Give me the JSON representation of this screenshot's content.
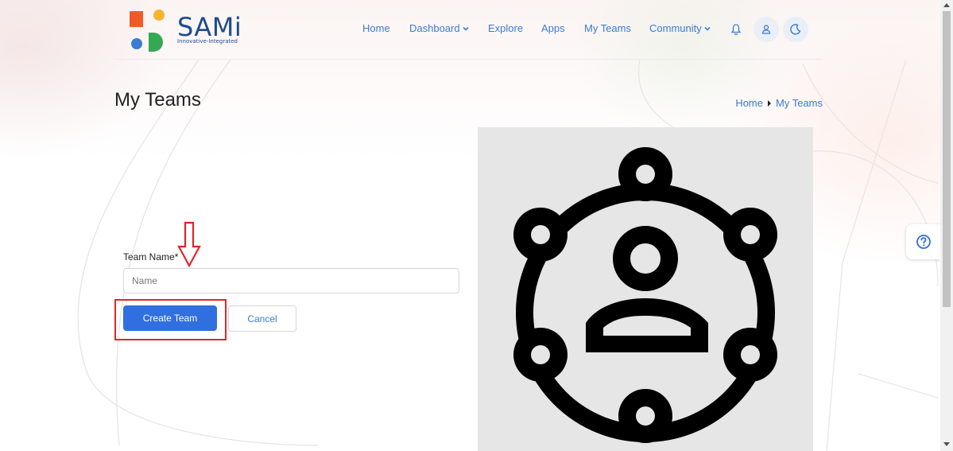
{
  "brand": {
    "name": "SAMi",
    "tagline": "Innovative-Integrated",
    "colors": {
      "orange": "#f05a28",
      "yellow": "#f7b42c",
      "blue": "#3a7bd5",
      "green": "#34a853",
      "navy": "#1d4b8f"
    }
  },
  "nav": {
    "items": [
      {
        "label": "Home",
        "has_dropdown": false
      },
      {
        "label": "Dashboard",
        "has_dropdown": true
      },
      {
        "label": "Explore",
        "has_dropdown": false
      },
      {
        "label": "Apps",
        "has_dropdown": false
      },
      {
        "label": "My Teams",
        "has_dropdown": false
      },
      {
        "label": "Community",
        "has_dropdown": true
      }
    ],
    "icons": [
      "bell-icon",
      "user-icon",
      "moon-icon"
    ]
  },
  "page": {
    "title": "My Teams",
    "breadcrumb": [
      "Home",
      "My Teams"
    ]
  },
  "form": {
    "team_name_label": "Team Name*",
    "team_name_placeholder": "Name",
    "team_name_value": "",
    "create_button": "Create Team",
    "cancel_button": "Cancel"
  },
  "image": {
    "icon": "team-network-icon"
  },
  "help": {
    "icon": "question-circle-icon"
  },
  "colors": {
    "accent": "#2f6fdf",
    "link": "#3a7bd5",
    "annotation": "#e0262b",
    "image_bg": "#e6e6e6"
  }
}
